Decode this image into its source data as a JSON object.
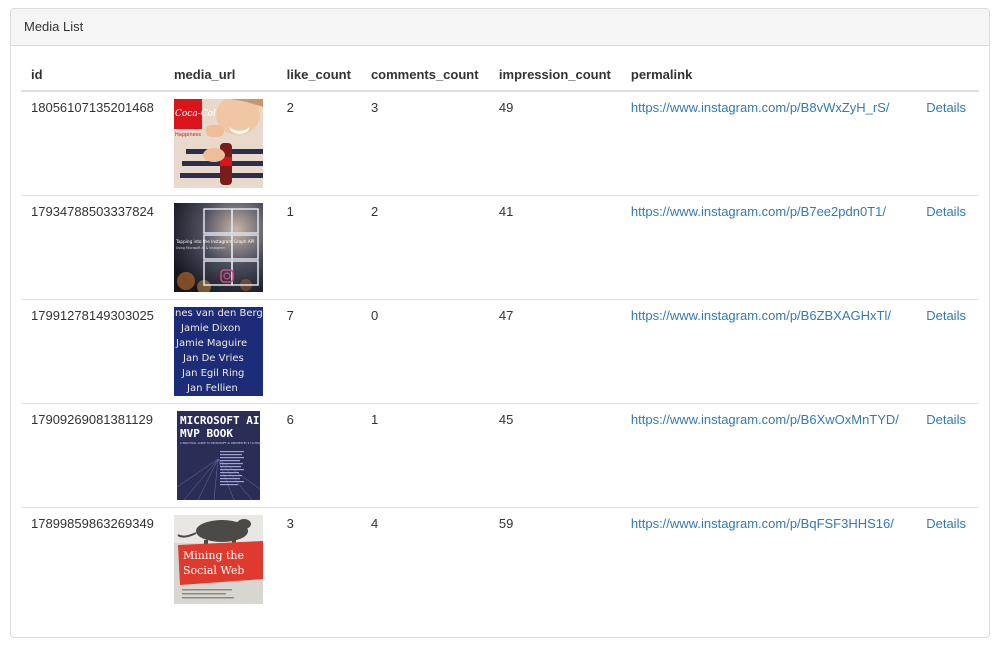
{
  "panel": {
    "title": "Media List"
  },
  "table": {
    "headers": [
      "id",
      "media_url",
      "like_count",
      "comments_count",
      "impression_count",
      "permalink",
      ""
    ],
    "rows": [
      {
        "id": "18056107135201468",
        "image": "cola-ad-photo",
        "like_count": "2",
        "comments_count": "3",
        "impression_count": "49",
        "permalink": "https://www.instagram.com/p/B8vWxZyH_rS/",
        "details": "Details"
      },
      {
        "id": "17934788503337824",
        "image": "instagram-tiles-photo",
        "like_count": "1",
        "comments_count": "2",
        "impression_count": "41",
        "permalink": "https://www.instagram.com/p/B7ee2pdn0T1/",
        "details": "Details"
      },
      {
        "id": "17991278149303025",
        "image": "names-list-cover",
        "like_count": "7",
        "comments_count": "0",
        "impression_count": "47",
        "permalink": "https://www.instagram.com/p/B6ZBXAGHxTl/",
        "details": "Details"
      },
      {
        "id": "17909269081381129",
        "image": "mvp-book-cover",
        "like_count": "6",
        "comments_count": "1",
        "impression_count": "45",
        "permalink": "https://www.instagram.com/p/B6XwOxMnTYD/",
        "details": "Details"
      },
      {
        "id": "17899859863269349",
        "image": "mining-social-web-cover",
        "like_count": "3",
        "comments_count": "4",
        "impression_count": "59",
        "permalink": "https://www.instagram.com/p/BqFSF3HHS16/",
        "details": "Details"
      }
    ]
  },
  "thumbnails": {
    "cola": {
      "brand": "Coca-Cola",
      "tag": "Happiness"
    },
    "tiles": {
      "caption1": "Tapping into the Instagram Graph API",
      "caption2": "Using Microsoft AI & Instagram"
    },
    "names": [
      "nes van den Berg",
      "Jamie Dixon",
      "Jamie Maguire",
      "Jan De Vries",
      "Jan Egil Ring",
      "Jan Fellien"
    ],
    "mvp": {
      "line1": "MICROSOFT AI",
      "line2": "MVP BOOK",
      "sub": "A PRACTICAL GUIDE TO MICROSOFT AI CREATED BY 27 AI MVPS"
    },
    "mining": {
      "line1": "Mining the",
      "line2": "Social Web"
    }
  },
  "colors": {
    "link": "#337ab7",
    "border": "#dddddd",
    "heading_bg": "#f5f5f5"
  }
}
